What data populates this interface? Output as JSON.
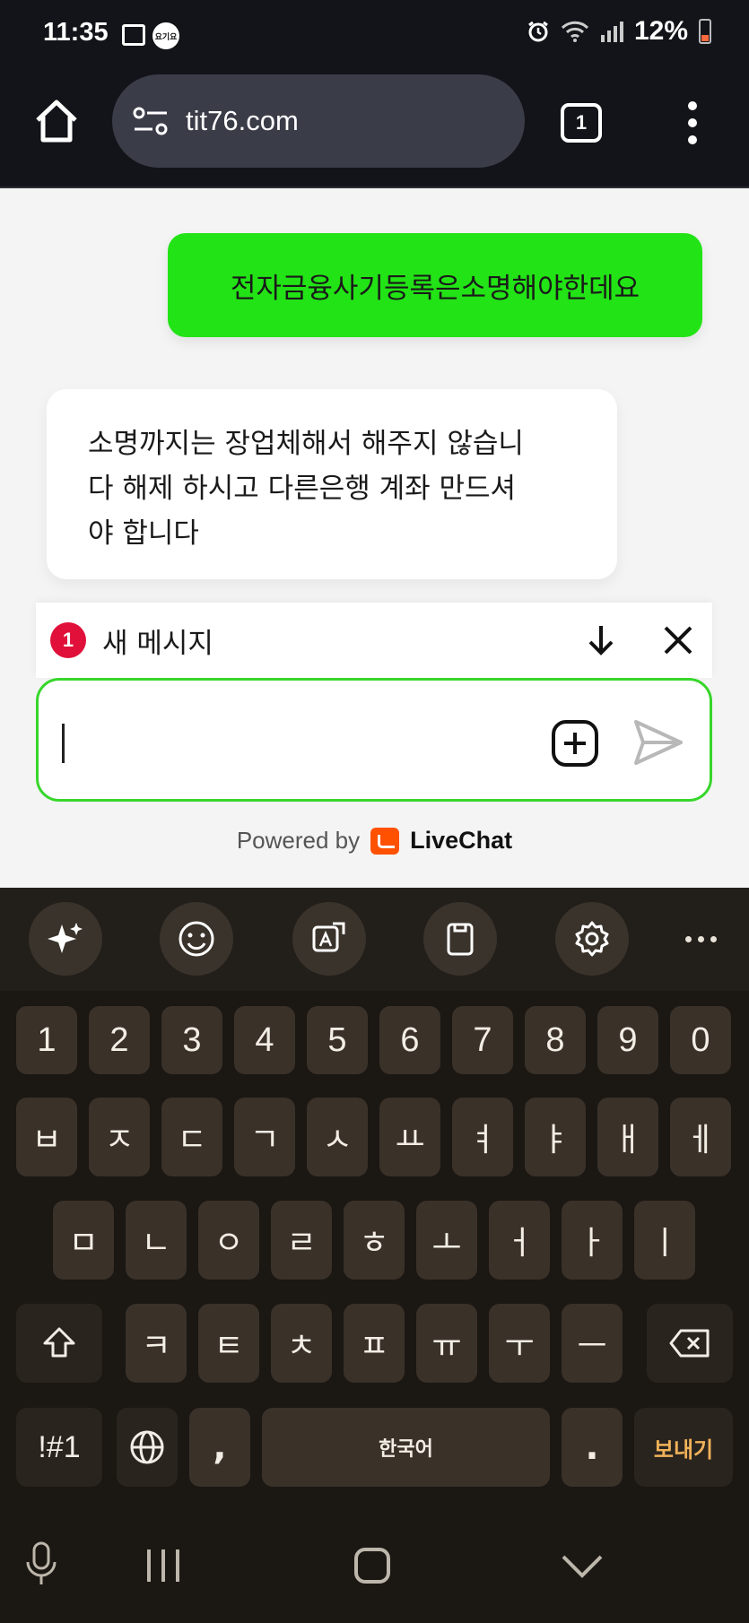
{
  "status_bar": {
    "time": "11:35",
    "badge_text": "요기요",
    "battery": "12%"
  },
  "browser": {
    "url": "tit76.com",
    "tab_count": "1"
  },
  "chat": {
    "messages": [
      {
        "sender": "user",
        "text": "전자금융사기등록은소명해야한데요"
      },
      {
        "sender": "agent",
        "lines": [
          "소명까지는 장업체해서 해주지 않습니",
          "다 해제 하시고 다른은행 계좌 만드셔",
          "야 합니다"
        ]
      }
    ],
    "new_message": {
      "count": "1",
      "label": "새 메시지"
    },
    "composer": {
      "value": "",
      "placeholder": ""
    },
    "powered_by": "Powered by",
    "brand": "LiveChat"
  },
  "keyboard": {
    "toolbar": [
      "ai-sparkle-icon",
      "emoji-icon",
      "translate-icon",
      "clipboard-icon",
      "settings-icon",
      "more-icon"
    ],
    "row_numbers": [
      "1",
      "2",
      "3",
      "4",
      "5",
      "6",
      "7",
      "8",
      "9",
      "0"
    ],
    "row1": [
      "ㅂ",
      "ㅈ",
      "ㄷ",
      "ㄱ",
      "ㅅ",
      "ㅛ",
      "ㅕ",
      "ㅑ",
      "ㅐ",
      "ㅔ"
    ],
    "row2": [
      "ㅁ",
      "ㄴ",
      "ㅇ",
      "ㄹ",
      "ㅎ",
      "ㅗ",
      "ㅓ",
      "ㅏ",
      "ㅣ"
    ],
    "row3": [
      "ㅋ",
      "ㅌ",
      "ㅊ",
      "ㅍ",
      "ㅠ",
      "ㅜ",
      "ㅡ"
    ],
    "bottom": {
      "symbols": "!#1",
      "comma": ",",
      "space": "한국어",
      "period": ".",
      "send": "보내기"
    }
  },
  "colors": {
    "user_bubble": "#22e315",
    "composer_border": "#37d62b",
    "badge": "#e0103a",
    "livechat": "#ff5100",
    "send_key": "#f1b25a"
  }
}
